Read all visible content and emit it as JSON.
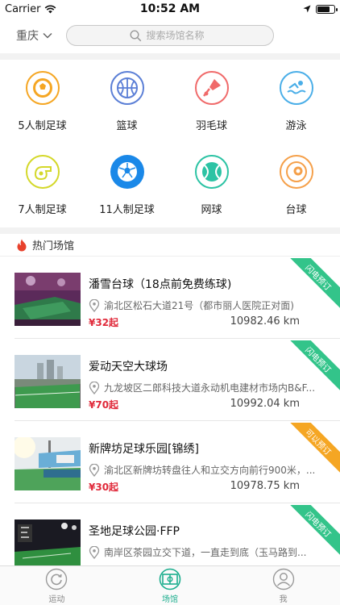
{
  "status": {
    "carrier": "Carrier",
    "time": "10:52 AM"
  },
  "header": {
    "city": "重庆",
    "search_placeholder": "搜索场馆名称"
  },
  "categories": [
    {
      "label": "5人制足球",
      "icon": "soccer-ball-icon",
      "color": "#f5a623"
    },
    {
      "label": "篮球",
      "icon": "basketball-icon",
      "color": "#5b7fd6"
    },
    {
      "label": "羽毛球",
      "icon": "badminton-icon",
      "color": "#f06a6a"
    },
    {
      "label": "游泳",
      "icon": "swimming-icon",
      "color": "#4aaee8"
    },
    {
      "label": "7人制足球",
      "icon": "whistle-icon",
      "color": "#d4d82a"
    },
    {
      "label": "11人制足球",
      "icon": "soccer-ball-icon",
      "color": "#1a88e8"
    },
    {
      "label": "网球",
      "icon": "tennis-ball-icon",
      "color": "#2cc3a4"
    },
    {
      "label": "台球",
      "icon": "billiards-icon",
      "color": "#f5a04a"
    }
  ],
  "hot_section": {
    "title": "热门场馆"
  },
  "venues": [
    {
      "name": "潘雪台球（18点前免费练球)",
      "address": "渝北区松石大道21号（都市丽人医院正对面)",
      "price": "¥32起",
      "distance": "10982.46 km",
      "badge": "闪电预订",
      "badge_color": "#33c48a",
      "photo": "billiard-hall-photo"
    },
    {
      "name": "爱动天空大球场",
      "address": "九龙坡区二郎科技大道永动机电建材市场内B&F...",
      "price": "¥70起",
      "distance": "10992.04 km",
      "badge": "闪电预订",
      "badge_color": "#33c48a",
      "photo": "rooftop-pitch-photo"
    },
    {
      "name": "新牌坊足球乐园[锦绣]",
      "address": "渝北区新牌坊转盘往人和立交方向前行900米，...",
      "price": "¥30起",
      "distance": "10978.75 km",
      "badge": "可以预订",
      "badge_color": "#f5a623",
      "photo": "football-park-photo"
    },
    {
      "name": "圣地足球公园·FFP",
      "address": "南岸区茶园立交下道，一直走到底（玉马路到...",
      "price": "",
      "distance": "",
      "badge": "闪电预订",
      "badge_color": "#33c48a",
      "photo": "night-pitch-photo"
    }
  ],
  "tabs": [
    {
      "label": "运动",
      "icon": "refresh-circle-icon"
    },
    {
      "label": "场馆",
      "icon": "pitch-icon"
    },
    {
      "label": "我",
      "icon": "user-icon"
    }
  ],
  "colors": {
    "accent": "#1cae8e",
    "price": "#e0293a"
  }
}
